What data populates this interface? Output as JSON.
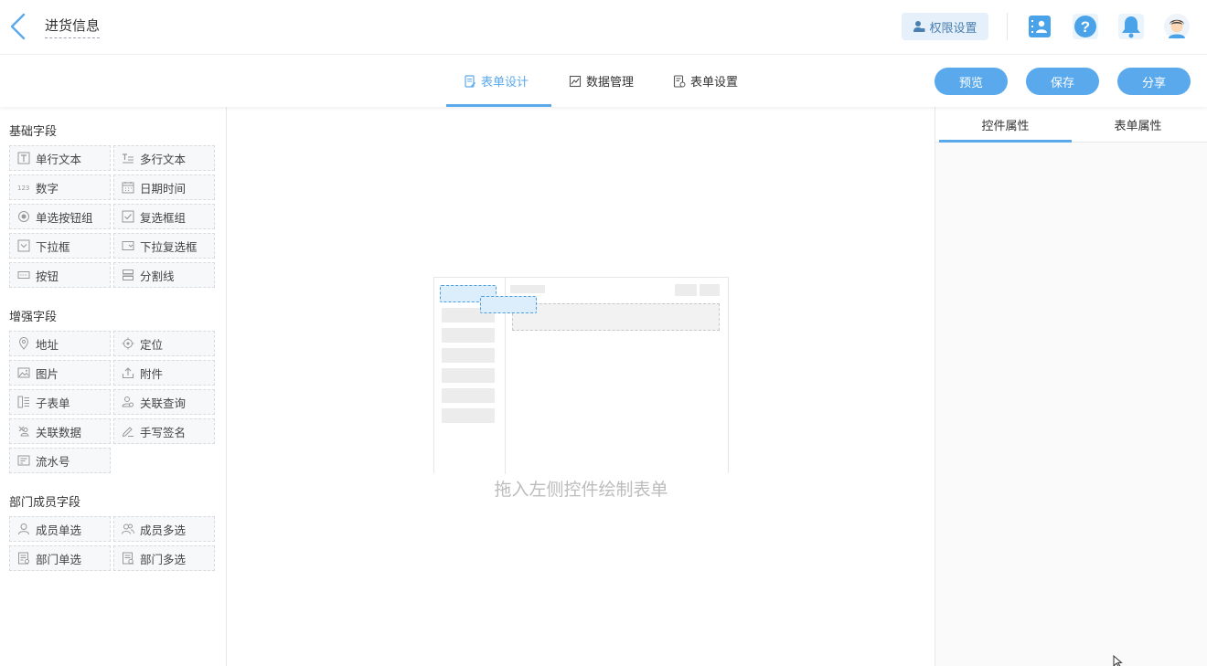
{
  "header": {
    "title": "进货信息",
    "permission_label": "权限设置"
  },
  "tabs": [
    {
      "label": "表单设计",
      "active": true
    },
    {
      "label": "数据管理",
      "active": false
    },
    {
      "label": "表单设置",
      "active": false
    }
  ],
  "actions": {
    "preview": "预览",
    "save": "保存",
    "share": "分享"
  },
  "left_panel": {
    "groups": [
      {
        "title": "基础字段",
        "fields": [
          {
            "label": "单行文本",
            "icon": "single-line-text-icon"
          },
          {
            "label": "多行文本",
            "icon": "multi-line-text-icon"
          },
          {
            "label": "数字",
            "icon": "number-icon"
          },
          {
            "label": "日期时间",
            "icon": "calendar-icon"
          },
          {
            "label": "单选按钮组",
            "icon": "radio-icon"
          },
          {
            "label": "复选框组",
            "icon": "checkbox-icon"
          },
          {
            "label": "下拉框",
            "icon": "dropdown-icon"
          },
          {
            "label": "下拉复选框",
            "icon": "dropdown-multi-icon"
          },
          {
            "label": "按钮",
            "icon": "button-icon"
          },
          {
            "label": "分割线",
            "icon": "divider-icon"
          }
        ]
      },
      {
        "title": "增强字段",
        "fields": [
          {
            "label": "地址",
            "icon": "map-pin-icon"
          },
          {
            "label": "定位",
            "icon": "locate-icon"
          },
          {
            "label": "图片",
            "icon": "image-icon"
          },
          {
            "label": "附件",
            "icon": "upload-icon"
          },
          {
            "label": "子表单",
            "icon": "subform-icon"
          },
          {
            "label": "关联查询",
            "icon": "linked-query-icon"
          },
          {
            "label": "关联数据",
            "icon": "linked-data-icon"
          },
          {
            "label": "手写签名",
            "icon": "signature-icon"
          },
          {
            "label": "流水号",
            "icon": "serial-number-icon"
          }
        ]
      },
      {
        "title": "部门成员字段",
        "fields": [
          {
            "label": "成员单选",
            "icon": "user-icon"
          },
          {
            "label": "成员多选",
            "icon": "users-icon"
          },
          {
            "label": "部门单选",
            "icon": "department-icon"
          },
          {
            "label": "部门多选",
            "icon": "departments-icon"
          }
        ]
      }
    ]
  },
  "canvas": {
    "empty_hint": "拖入左侧控件绘制表单"
  },
  "right_panel": {
    "tabs": [
      {
        "label": "控件属性",
        "active": true
      },
      {
        "label": "表单属性",
        "active": false
      }
    ]
  },
  "colors": {
    "accent": "#5aa9ec",
    "icon_blue": "#4aa3e8",
    "field_border": "#d8dbe0"
  }
}
